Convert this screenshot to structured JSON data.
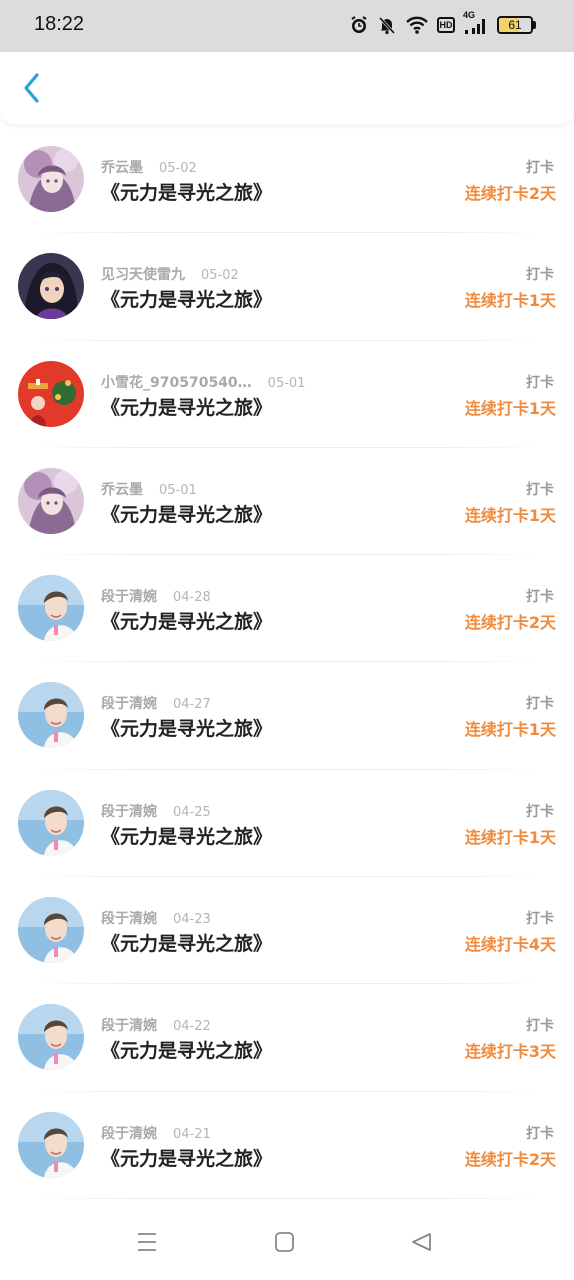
{
  "status_bar": {
    "time": "18:22",
    "network_label": "4G",
    "hd_label": "HD",
    "battery_level": "61",
    "battery_fraction": 0.61,
    "icons": [
      "alarm-icon",
      "mute-icon",
      "wifi-icon",
      "hd-icon",
      "signal-icon",
      "battery-icon"
    ]
  },
  "header": {
    "back_icon": "chevron-left-icon",
    "accent": "#2a9fd8"
  },
  "colors": {
    "streak": "#f08a3c",
    "username": "#a9a9a9",
    "title": "#222222"
  },
  "records": [
    {
      "user": "乔云墨",
      "date": "05-02",
      "title": "《元力是寻光之旅》",
      "action": "打卡",
      "streak": "连续打卡2天",
      "avatar": "anime-girl-avatar"
    },
    {
      "user": "见习天使雷九",
      "date": "05-02",
      "title": "《元力是寻光之旅》",
      "action": "打卡",
      "streak": "连续打卡1天",
      "avatar": "dark-hair-character-avatar"
    },
    {
      "user": "小雪花_970570540…",
      "date": "05-01",
      "title": "《元力是寻光之旅》",
      "action": "打卡",
      "streak": "连续打卡1天",
      "avatar": "red-festive-avatar"
    },
    {
      "user": "乔云墨",
      "date": "05-01",
      "title": "《元力是寻光之旅》",
      "action": "打卡",
      "streak": "连续打卡1天",
      "avatar": "anime-girl-avatar"
    },
    {
      "user": "段于清婉",
      "date": "04-28",
      "title": "《元力是寻光之旅》",
      "action": "打卡",
      "streak": "连续打卡2天",
      "avatar": "boy-photo-avatar"
    },
    {
      "user": "段于清婉",
      "date": "04-27",
      "title": "《元力是寻光之旅》",
      "action": "打卡",
      "streak": "连续打卡1天",
      "avatar": "boy-photo-avatar"
    },
    {
      "user": "段于清婉",
      "date": "04-25",
      "title": "《元力是寻光之旅》",
      "action": "打卡",
      "streak": "连续打卡1天",
      "avatar": "boy-photo-avatar"
    },
    {
      "user": "段于清婉",
      "date": "04-23",
      "title": "《元力是寻光之旅》",
      "action": "打卡",
      "streak": "连续打卡4天",
      "avatar": "boy-photo-avatar"
    },
    {
      "user": "段于清婉",
      "date": "04-22",
      "title": "《元力是寻光之旅》",
      "action": "打卡",
      "streak": "连续打卡3天",
      "avatar": "boy-photo-avatar"
    },
    {
      "user": "段于清婉",
      "date": "04-21",
      "title": "《元力是寻光之旅》",
      "action": "打卡",
      "streak": "连续打卡2天",
      "avatar": "boy-photo-avatar"
    }
  ],
  "nav_bar": {
    "icons": [
      "menu-icon",
      "home-square-icon",
      "back-triangle-icon"
    ]
  }
}
